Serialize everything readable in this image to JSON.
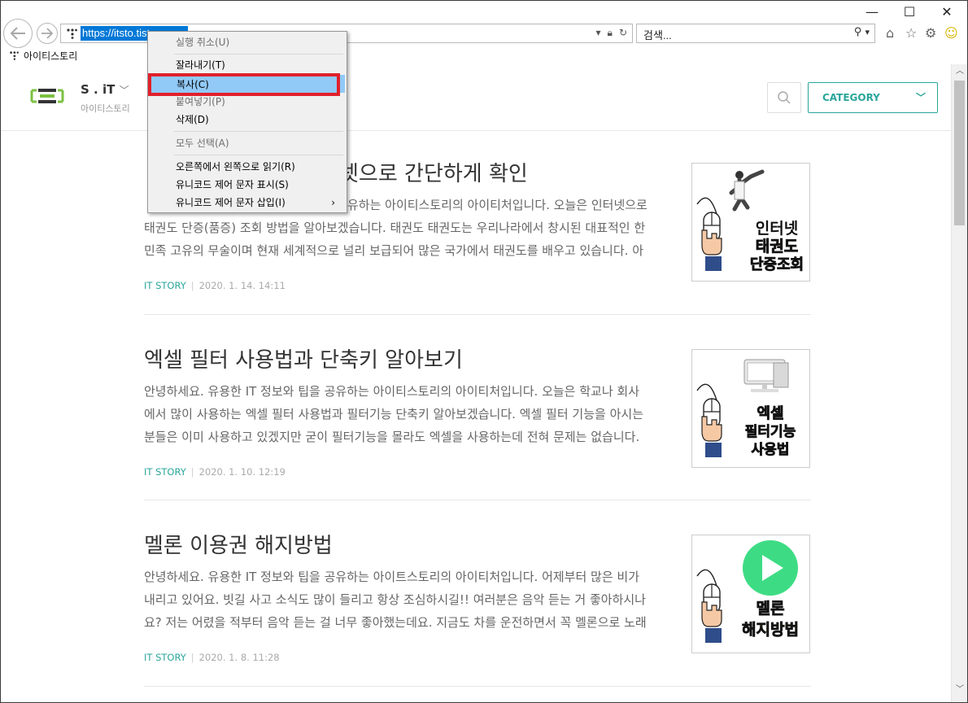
{
  "browser": {
    "url": "https://itsto.tist",
    "search_placeholder": "검색...",
    "tab_title": "아이티스토리",
    "minimize": "—",
    "maximize": "☐",
    "close": "✕"
  },
  "site": {
    "name": "S . iT",
    "subtitle": "아이티스토리",
    "category_label": "CATEGORY"
  },
  "posts": [
    {
      "title": "넷으로 간단하게 확인",
      "excerpt": "유하는 아이티스토리의 아이티처입니다. 오늘은 인터넷으로 태권도 단증(품증) 조회 방법을 알아보겠습니다. 태권도 태권도는 우리나라에서 창시된 대표적인 한민족 고유의 무술이며 현재 세계적으로 널리 보급되어 많은 국가에서 태권도를 배우고 있습니다. 아",
      "excerpt_lines": [
        "유하는 아이티스토리의 아이티처입니다. 오늘은 인터넷으로",
        "태권도 단증(품증) 조회 방법을 알아보겠습니다. 태권도 태권도는 우리나라에서 창시된 대표적인 한",
        "민족 고유의 무술이며 현재 세계적으로 널리 보급되어 많은 국가에서 태권도를 배우고 있습니다. 아"
      ],
      "category": "IT STORY",
      "date": "2020. 1. 14. 14:11",
      "thumb_lines": [
        "인터넷",
        "태권도",
        "단증조회"
      ]
    },
    {
      "title": "엑셀 필터 사용법과 단축키 알아보기",
      "excerpt_lines": [
        "안녕하세요. 유용한 IT 정보와 팁을 공유하는 아이티스토리의 아이티처입니다. 오늘은 학교나 회사",
        "에서 많이 사용하는 엑셀 필터 사용법과 필터기능 단축키 알아보겠습니다. 엑셀 필터 기능을 아시는",
        "분들은 이미 사용하고 있겠지만 굳이 필터기능을 몰라도 엑셀을 사용하는데 전혀 문제는 없습니다."
      ],
      "category": "IT STORY",
      "date": "2020. 1. 10. 12:19",
      "thumb_lines": [
        "엑셀",
        "필터기능",
        "사용법"
      ]
    },
    {
      "title": "멜론 이용권 해지방법",
      "excerpt_lines": [
        "안녕하세요. 유용한 IT 정보와 팁을 공유하는 아이트스토리의 아이티처입니다. 어제부터 많은 비가",
        "내리고 있어요. 빗길 사고 소식도 많이 들리고 항상 조심하시길!! 여러분은 음악 듣는 거 좋아하시나",
        "요? 저는 어렸을 적부터 음악 듣는 걸 너무 좋아했는데요. 지금도 차를 운전하면서 꼭 멜론으로 노래"
      ],
      "category": "IT STORY",
      "date": "2020. 1. 8. 11:28",
      "thumb_lines": [
        "멜론",
        "해지방법"
      ]
    }
  ],
  "context_menu": {
    "items": [
      {
        "label": "실행 취소(U)",
        "enabled": false
      },
      {
        "label": "잘라내기(T)",
        "enabled": true
      },
      {
        "label": "복사(C)",
        "enabled": true,
        "highlighted": true
      },
      {
        "label": "붙여넣기(P)",
        "enabled": false
      },
      {
        "label": "삭제(D)",
        "enabled": true
      },
      {
        "label": "모두 선택(A)",
        "enabled": false
      },
      {
        "label": "오른쪽에서 왼쪽으로 읽기(R)",
        "enabled": true
      },
      {
        "label": "유니코드 제어 문자 표시(S)",
        "enabled": true
      },
      {
        "label": "유니코드 제어 문자 삽입(I)",
        "enabled": true,
        "submenu": true
      }
    ]
  },
  "colors": {
    "accent": "#2aa59b",
    "highlight_box": "#e1202b",
    "menu_highlight": "#91c9f7",
    "url_selection": "#0078d7"
  }
}
